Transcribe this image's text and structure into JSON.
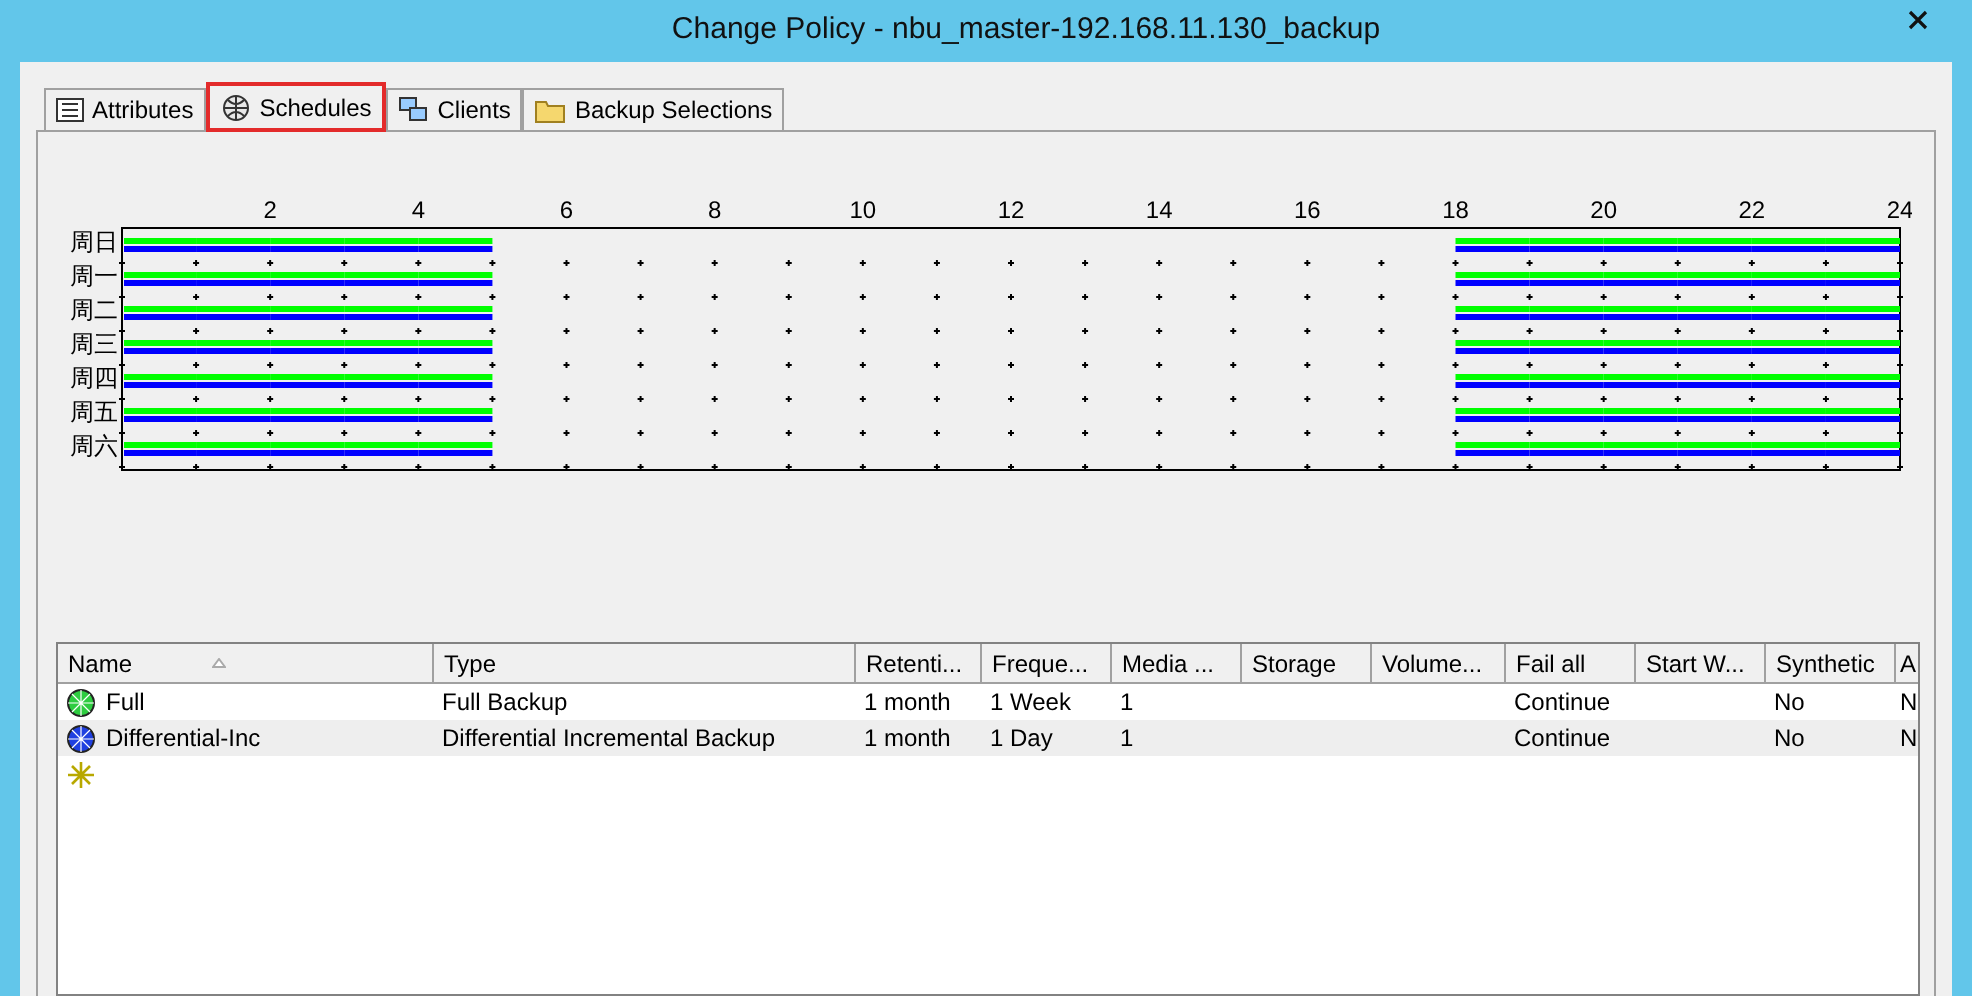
{
  "window": {
    "title": "Change Policy - nbu_master-192.168.11.130_backup"
  },
  "tabs": [
    {
      "label": "Attributes",
      "selected": false
    },
    {
      "label": "Schedules",
      "selected": true
    },
    {
      "label": "Clients",
      "selected": false
    },
    {
      "label": "Backup Selections",
      "selected": false
    }
  ],
  "schedule_grid": {
    "hour_labels": [
      "2",
      "4",
      "6",
      "8",
      "10",
      "12",
      "14",
      "16",
      "18",
      "20",
      "22",
      "24"
    ],
    "days": [
      {
        "label": "周日",
        "slots": [
          true,
          true,
          true,
          true,
          true,
          false,
          false,
          false,
          false,
          false,
          false,
          false,
          false,
          false,
          false,
          false,
          false,
          false,
          true,
          true,
          true,
          true,
          true,
          true
        ]
      },
      {
        "label": "周一",
        "slots": [
          true,
          true,
          true,
          true,
          true,
          false,
          false,
          false,
          false,
          false,
          false,
          false,
          false,
          false,
          false,
          false,
          false,
          false,
          true,
          true,
          true,
          true,
          true,
          true
        ]
      },
      {
        "label": "周二",
        "slots": [
          true,
          true,
          true,
          true,
          true,
          false,
          false,
          false,
          false,
          false,
          false,
          false,
          false,
          false,
          false,
          false,
          false,
          false,
          true,
          true,
          true,
          true,
          true,
          true
        ]
      },
      {
        "label": "周三",
        "slots": [
          true,
          true,
          true,
          true,
          true,
          false,
          false,
          false,
          false,
          false,
          false,
          false,
          false,
          false,
          false,
          false,
          false,
          false,
          true,
          true,
          true,
          true,
          true,
          true
        ]
      },
      {
        "label": "周四",
        "slots": [
          true,
          true,
          true,
          true,
          true,
          false,
          false,
          false,
          false,
          false,
          false,
          false,
          false,
          false,
          false,
          false,
          false,
          false,
          true,
          true,
          true,
          true,
          true,
          true
        ]
      },
      {
        "label": "周五",
        "slots": [
          true,
          true,
          true,
          true,
          true,
          false,
          false,
          false,
          false,
          false,
          false,
          false,
          false,
          false,
          false,
          false,
          false,
          false,
          true,
          true,
          true,
          true,
          true,
          true
        ]
      },
      {
        "label": "周六",
        "slots": [
          true,
          true,
          true,
          true,
          true,
          false,
          false,
          false,
          false,
          false,
          false,
          false,
          false,
          false,
          false,
          false,
          false,
          false,
          true,
          true,
          true,
          true,
          true,
          true
        ]
      }
    ]
  },
  "table": {
    "columns": [
      "Name",
      "Type",
      "Retenti...",
      "Freque...",
      "Media ...",
      "Storage",
      "Volume...",
      "Fail all",
      "Start W...",
      "Synthetic",
      "A"
    ],
    "rows": [
      {
        "kind": "full",
        "cells": [
          "Full",
          "Full Backup",
          "1 month",
          "1 Week",
          "1",
          "",
          "",
          "Continue",
          "",
          "No",
          "N"
        ]
      },
      {
        "kind": "incremental",
        "cells": [
          "Differential-Inc",
          "Differential Incremental Backup",
          "1 month",
          "1 Day",
          "1",
          "",
          "",
          "Continue",
          "",
          "No",
          "N"
        ]
      }
    ]
  }
}
